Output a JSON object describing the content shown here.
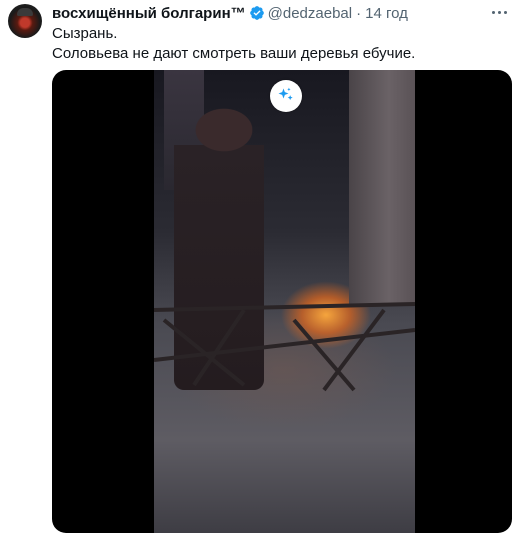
{
  "tweet": {
    "display_name": "восхищённый болгарин™",
    "handle": "@dedzaebal",
    "separator": "·",
    "time": "14 год",
    "text_lines": [
      "Сызрань.",
      "Соловьева не дают смотреть ваши деревья ебучие."
    ]
  },
  "icons": {
    "verified": "verified-badge-icon",
    "more": "more-options-icon",
    "media_action": "sparkle-icon"
  },
  "colors": {
    "verified": "#1d9bf0",
    "secondary_text": "#536471",
    "primary_text": "#0f1419",
    "sparkle": "#1d9bf0"
  }
}
